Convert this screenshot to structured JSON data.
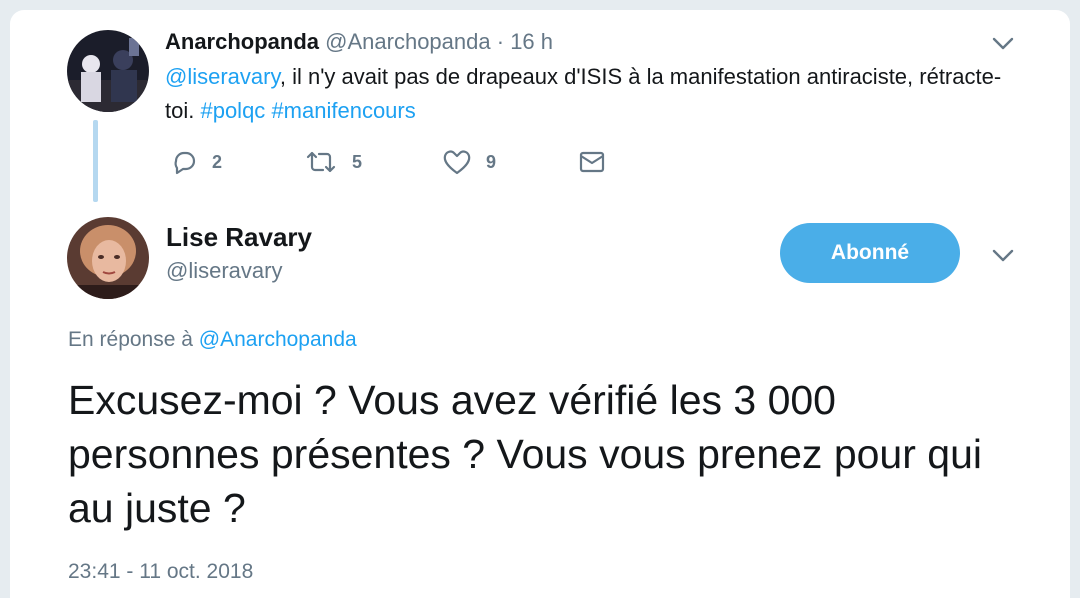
{
  "reply_tweet": {
    "author_name": "Anarchopanda",
    "author_handle": "@Anarchopanda",
    "separator": "·",
    "time_ago": "16 h",
    "mention": "@liseravary",
    "text_body": ", il n'y avait pas de drapeaux d'ISIS à la manifestation antiraciste, rétracte-toi. ",
    "hashtag_1": "#polqc",
    "hashtag_2": "#manifencours",
    "actions": {
      "reply_count": "2",
      "retweet_count": "5",
      "like_count": "9"
    },
    "icons": [
      "reply-icon",
      "retweet-icon",
      "like-icon",
      "direct-message-icon",
      "chevron-down-icon"
    ]
  },
  "main_tweet": {
    "author_name": "Lise Ravary",
    "author_handle": "@liseravary",
    "follow_label": "Abonné",
    "reply_prefix": "En réponse à ",
    "reply_to_handle": "@Anarchopanda",
    "text": "Excusez-moi ? Vous avez vérifié les 3 000 personnes présentes ? Vous vous prenez pour qui au juste ?",
    "timestamp": "23:41 - 11 oct. 2018"
  },
  "colors": {
    "accent": "#1da1f2",
    "follow_button": "#4aaee8",
    "muted_text": "#657786",
    "thread_line": "#b5d8f0"
  }
}
